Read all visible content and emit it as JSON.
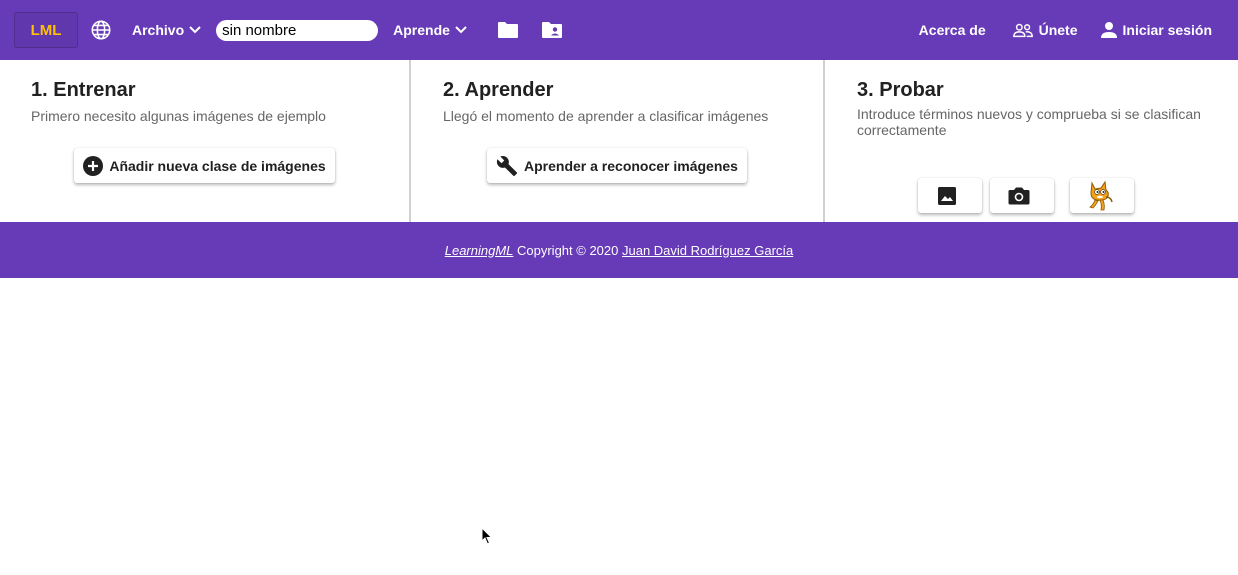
{
  "header": {
    "logo": "LML",
    "menus": {
      "archivo": "Archivo",
      "aprende": "Aprende"
    },
    "project_name": "sin nombre",
    "right": {
      "about": "Acerca de",
      "join": "Únete",
      "login": "Iniciar sesión"
    },
    "icons": [
      "globe-icon",
      "chevron-down-icon",
      "folder-icon",
      "folder-user-icon",
      "group-icon",
      "person-icon"
    ],
    "colors": {
      "bar": "#673ab7",
      "logo_text": "#ffc107"
    }
  },
  "panels": [
    {
      "title": "1. Entrenar",
      "subtitle": "Primero necesito algunas imágenes de ejemplo",
      "button": "Añadir nueva clase de imágenes"
    },
    {
      "title": "2. Aprender",
      "subtitle": "Llegó el momento de aprender a clasificar imágenes",
      "button": "Aprender a reconocer imágenes"
    },
    {
      "title": "3. Probar",
      "subtitle": "Introduce términos nuevos y comprueba si se clasifican correctamente",
      "tools": [
        "image-icon",
        "camera-icon",
        "scratch-cat-icon"
      ]
    }
  ],
  "footer": {
    "brand": "LearningML",
    "copyright": " Copyright © 2020 ",
    "author": "Juan David Rodríguez García"
  }
}
